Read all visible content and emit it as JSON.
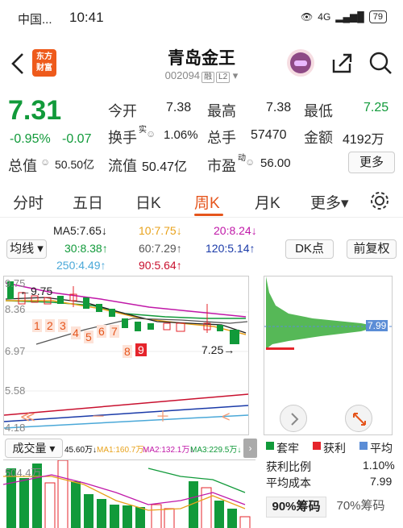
{
  "status": {
    "carrier": "中国...",
    "time": "10:41",
    "network": "4G",
    "battery": "79"
  },
  "header": {
    "logo_line1": "东方",
    "logo_line2": "财富",
    "title": "青岛金王",
    "code": "002094",
    "tag1": "融",
    "tag2": "L2"
  },
  "quote": {
    "price": "7.31",
    "change_pct": "-0.95%",
    "change": "-0.07",
    "open_label": "今开",
    "open": "7.38",
    "high_label": "最高",
    "high": "7.38",
    "low_label": "最低",
    "low": "7.25",
    "turnover_label": "换手",
    "turnover_sup": "实",
    "turnover": "1.06%",
    "volume_label": "总手",
    "volume": "57470",
    "amount_label": "金额",
    "amount": "4192万",
    "mktcap_label": "总值",
    "mktcap": "50.50亿",
    "float_label": "流值",
    "float": "50.47亿",
    "pe_label": "市盈",
    "pe_sup": "动",
    "pe": "56.00",
    "more": "更多"
  },
  "tabs": [
    "分时",
    "五日",
    "日K",
    "周K",
    "月K",
    "更多▾"
  ],
  "ma": {
    "select": "均线 ▾",
    "ma5": "MA5:7.65↓",
    "ma10": "10:7.75↓",
    "ma20": "20:8.24↓",
    "ma30": "30:8.38↑",
    "ma60": "60:7.29↑",
    "ma120": "120:5.14↑",
    "ma250": "250:4.49↑",
    "ma90": "90:5.64↑",
    "dk": "DK点",
    "adj": "前复权"
  },
  "chart_labels": {
    "y_top": "9.75",
    "y_830": "8.36",
    "y_697": "6.97",
    "y_558": "5.58",
    "y_418": "4.18",
    "hi_mark": "←9.75",
    "lo_mark": "7.25→",
    "vp_price": "7.99",
    "numbers": [
      "1",
      "2",
      "3",
      "4",
      "5",
      "6",
      "7",
      "8",
      "9"
    ]
  },
  "colors": {
    "up": "#e5242b",
    "down": "#119a3a",
    "accent": "#e5551c",
    "ma5": "#222222",
    "ma10": "#e8a21b",
    "ma20": "#c018a8",
    "ma30": "#119a3a",
    "ma250": "#4aa8d8",
    "ma120": "#1a3aa8",
    "ma90": "#c8102e"
  },
  "volume": {
    "select": "成交量 ▾",
    "v": "45.60万↓",
    "ma1": "MA1:160.7万↓",
    "ma2": "MA2:132.1万↓",
    "ma3": "MA3:229.5万↓",
    "ylabel": "504.4万"
  },
  "chips": {
    "leg1": "套牢",
    "leg2": "获利",
    "leg3": "平均",
    "ratio_label": "获利比例",
    "ratio": "1.10%",
    "avg_label": "平均成本",
    "avg": "7.99",
    "tab1": "90%筹码",
    "tab2": "70%筹码"
  }
}
